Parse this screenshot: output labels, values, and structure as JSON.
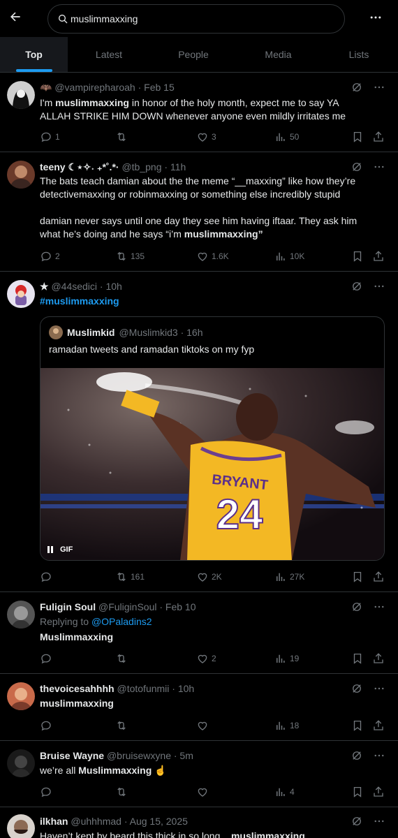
{
  "search": {
    "query": "muslimmaxxing"
  },
  "tabs": [
    {
      "label": "Top",
      "active": true
    },
    {
      "label": "Latest"
    },
    {
      "label": "People"
    },
    {
      "label": "Media"
    },
    {
      "label": "Lists"
    }
  ],
  "tweets": [
    {
      "name": "",
      "handle": "🦇 @vampirepharoah · Feb 15",
      "text_pre": "I'm ",
      "text_bold": "muslimmaxxing",
      "text_line1_post": " in honor of the holy month, expect me to say YA",
      "text_line2": "ALLAH STRIKE HIM DOWN whenever anyone even mildly irritates me",
      "replies": "1",
      "retweets": "",
      "likes": "3",
      "views": "50"
    },
    {
      "name": "teeny ☾⋆✧˖ ₊*˚.*·",
      "handle": "@tb_png · 11h",
      "line1": "The bats teach damian about the the meme “__maxxing” like how they’re",
      "line2": "detectivemaxxing or robinmaxxing or something else incredibly stupid",
      "line3": "damian never says until one day they see him having iftaar. They ask him",
      "line4_pre": "what he’s doing and he says “i’m ",
      "line4_bold": "muslimmaxxing”",
      "replies": "2",
      "retweets": "135",
      "likes": "1.6K",
      "views": "10K"
    },
    {
      "name": "★",
      "handle": "@44sedici · 10h",
      "hashtag": "#muslimmaxxing",
      "quote": {
        "name": "Muslimkid",
        "handle": "@Muslimkid3 · 16h",
        "text": "ramadan tweets and ramadan tiktoks on my fyp",
        "gif_label": "GIF",
        "jersey_name": "BRYANT",
        "jersey_number": "24"
      },
      "replies": "",
      "retweets": "161",
      "likes": "2K",
      "views": "27K"
    },
    {
      "name": "Fuligin Soul",
      "handle": "@FuliginSoul · Feb 10",
      "reply_prefix": "Replying to ",
      "reply_to": "@OPaladins2",
      "text": "Muslimmaxxing",
      "replies": "",
      "retweets": "",
      "likes": "2",
      "views": "19"
    },
    {
      "name": "thevoicesahhhh",
      "handle": "@totofunmii · 10h",
      "text": "muslimmaxxing",
      "replies": "",
      "retweets": "",
      "likes": "",
      "views": "18"
    },
    {
      "name": "Bruise Wayne",
      "handle": "@bruisewxyne · 5m",
      "text_pre": "we’re all ",
      "text_bold": "Muslimmaxxing",
      "text_emoji": " ☝",
      "replies": "",
      "retweets": "",
      "likes": "",
      "views": "4"
    },
    {
      "name": "ilkhan",
      "handle": "@uhhhmad · Aug 15, 2025",
      "text_pre": "Haven’t kept by beard this thick in so long... ",
      "text_bold": "muslimmaxxing"
    }
  ],
  "colors": {
    "accent": "#1d9bf0",
    "muted": "#71767b",
    "text": "#e7e9ea",
    "border": "#2f3336"
  }
}
